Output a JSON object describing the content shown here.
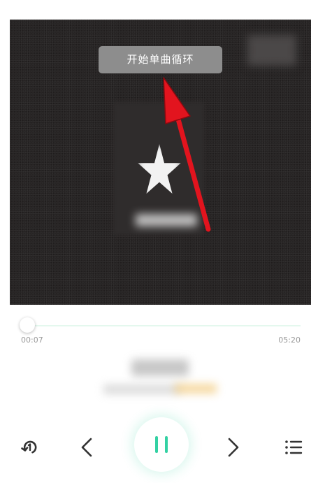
{
  "toast": {
    "text": "开始单曲循环"
  },
  "player": {
    "time_current": "00:07",
    "time_total": "05:20",
    "progress": 0.022
  },
  "controls": {
    "mode_icon": "single-repeat-icon",
    "prev_icon": "chevron-left-icon",
    "play_icon": "pause-icon",
    "next_icon": "chevron-right-icon",
    "list_icon": "playlist-icon"
  },
  "colors": {
    "accent": "#33d1a3",
    "annotation": "#e2141e",
    "toast_bg": "#8d8d8d"
  }
}
